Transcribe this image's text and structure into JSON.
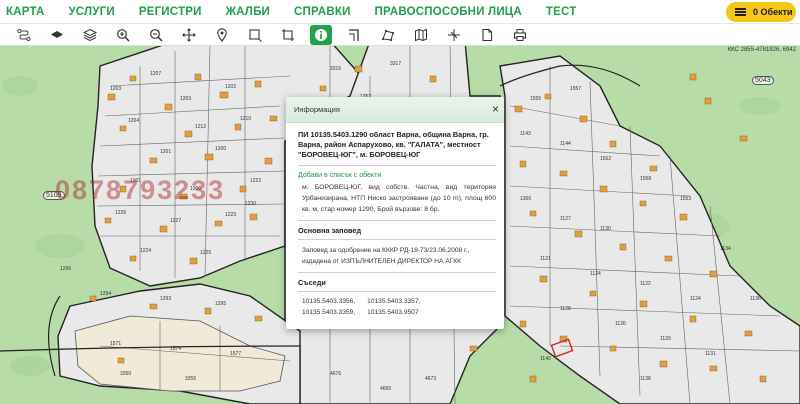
{
  "nav": {
    "items": [
      "КАРТА",
      "УСЛУГИ",
      "РЕГИСТРИ",
      "ЖАЛБИ",
      "СПРАВКИ",
      "ПРАВОСПОСОБНИ ЛИЦА",
      "ТЕСТ"
    ],
    "objects_button": "0 Обекти"
  },
  "toolbar": {
    "tools": [
      "route-icon",
      "layer-icon",
      "layers-stack-icon",
      "zoom-in-icon",
      "zoom-out-icon",
      "pan-icon",
      "location-pin-icon",
      "select-rectangle-icon",
      "rectangle-crop-icon",
      "info-icon",
      "corner-angle-icon",
      "polygon-measure-icon",
      "map-book-icon",
      "split-icon",
      "document-icon",
      "print-icon"
    ],
    "active_tool": "info-icon"
  },
  "map": {
    "kks_label": "ККС 2855-4781926, 6942",
    "region_label_1": "5043",
    "region_label_2": "5109",
    "watermark": "0878793233",
    "parcel_labels": [
      "1203",
      "1207",
      "1203",
      "1202",
      "1204",
      "1212",
      "1210",
      "1201",
      "1200",
      "1301",
      "1306",
      "1222",
      "1226",
      "1227",
      "1223",
      "1224",
      "1225",
      "1230",
      "1231",
      "1232",
      "1229",
      "1216",
      "1217",
      "3321",
      "3323",
      "3324",
      "3325",
      "3326",
      "1294",
      "1293",
      "1295",
      "1296",
      "1298",
      "1270",
      "1269",
      "1268",
      "1267",
      "1272",
      "1273",
      "1272",
      "1571",
      "1574",
      "1577",
      "3350",
      "3355",
      "3351",
      "3350",
      "3352",
      "4676",
      "4665",
      "4673",
      "4670",
      "4671",
      "1300",
      "1302",
      "1306",
      "1127",
      "1130",
      "1121",
      "1124",
      "1122",
      "1124",
      "1128",
      "1126",
      "1129",
      "1131",
      "1140",
      "1145",
      "1134",
      "1136",
      "1138",
      "1137",
      "1139",
      "1143",
      "1144",
      "1562",
      "1558",
      "1553",
      "1555",
      "1557",
      "1577",
      "1532",
      "1537",
      "3301",
      "3302",
      "1351",
      "1352",
      "1346",
      "3318",
      "3316",
      "3317",
      "1317",
      "1313",
      "1314",
      "1320",
      "1328",
      "1319",
      "3383",
      "1300",
      "1308",
      "1310",
      "1311",
      "3343",
      "3371",
      "1356",
      "3360",
      "1347"
    ]
  },
  "popup": {
    "header": "Информация",
    "close": "×",
    "title": "ПИ 10135.5403.1290 област Варна, община Варна, гр. Варна, район Аспарухово, кв. \"ГАЛАТА\", местност \"БОРОВЕЦ-ЮГ\", м. БОРОВЕЦ-ЮГ",
    "add_link": "Добави в списък с обекти",
    "description": "м. БОРОВЕЦ-ЮГ, вид собств. Частна, вид територия Урбанизирана, НТП Ниско застрояване (до 10 m), площ 600 кв. м, стар номер 1290, Брой вързове: 8 бр.",
    "order_heading": "Основна заповед",
    "order_text": "Заповед за одобрение на КККР РД-18-73/23.06.2008 г., издадена от ИЗПЪЛНИТЕЛЕН ДИРЕКТОР НА АГКК",
    "neighbors_heading": "Съседи",
    "neighbors": [
      "10135.5403.3356,",
      "10135.5403.3357,",
      "10135.5403.3359,",
      "10135.5403.9507"
    ]
  },
  "colors": {
    "brand_green": "#20a048",
    "accent_yellow": "#f5c518",
    "map_green": "#b7dca8",
    "parcel_grey": "#ececec",
    "building_orange": "#e0a040"
  }
}
